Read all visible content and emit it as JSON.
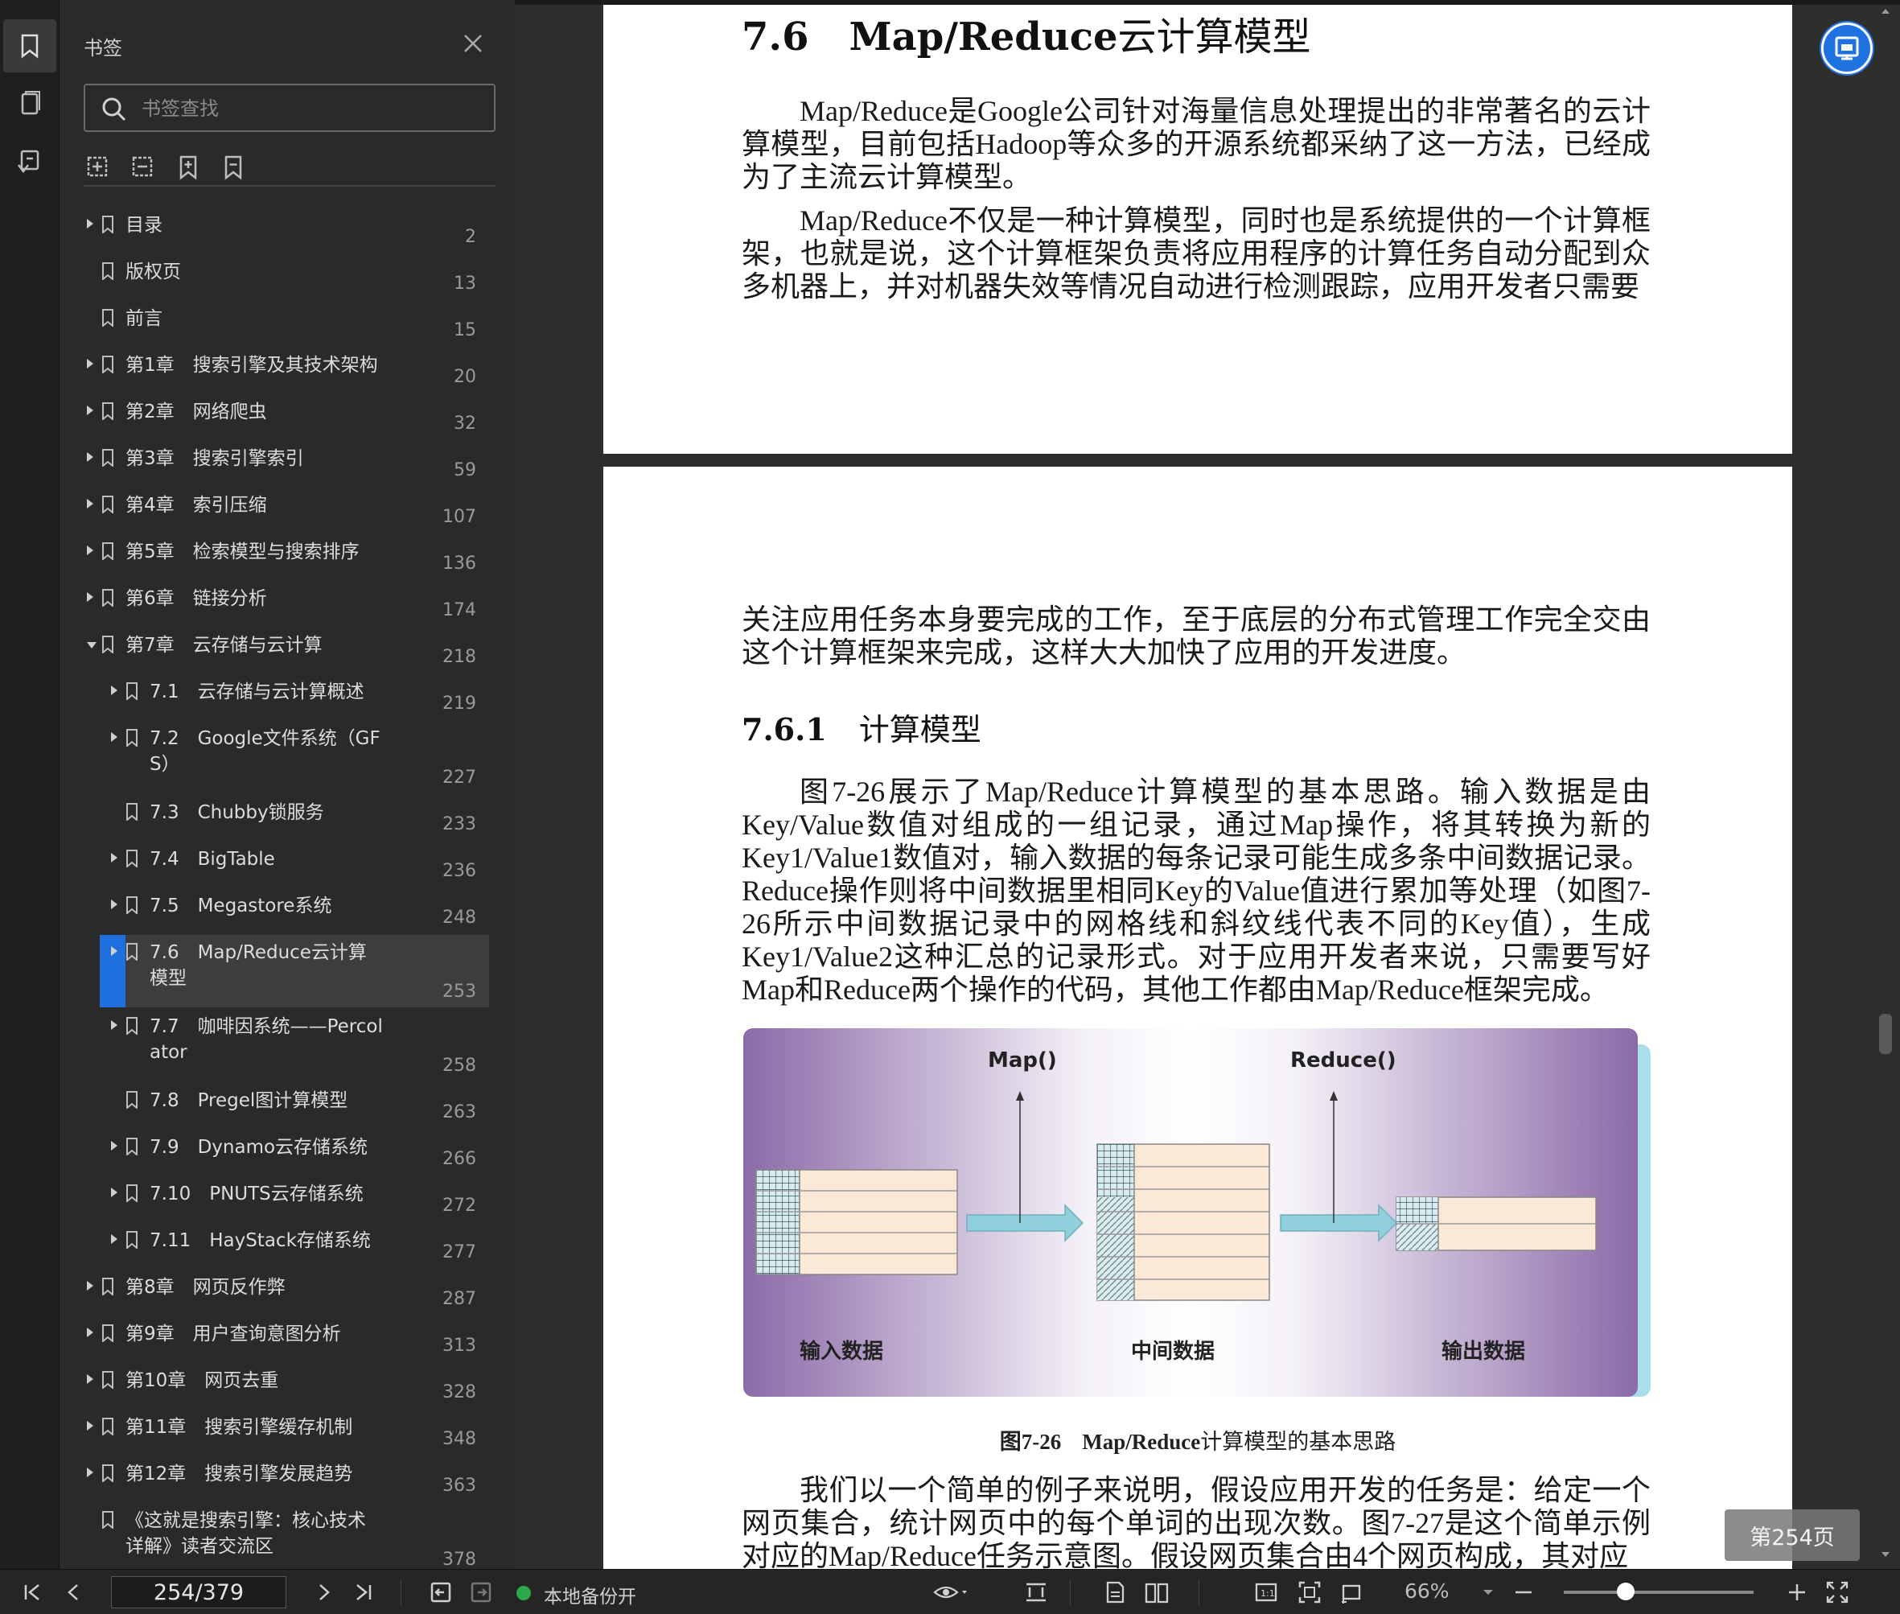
{
  "panel": {
    "title": "书签",
    "search_placeholder": "书签查找"
  },
  "bookmarks": [
    {
      "label": "目录",
      "page": "2",
      "level": 0,
      "arrow": "closed"
    },
    {
      "label": "版权页",
      "page": "13",
      "level": 0,
      "arrow": "none"
    },
    {
      "label": "前言",
      "page": "15",
      "level": 0,
      "arrow": "none"
    },
    {
      "label": "第1章　搜索引擎及其技术架构",
      "page": "20",
      "level": 0,
      "arrow": "closed"
    },
    {
      "label": "第2章　网络爬虫",
      "page": "32",
      "level": 0,
      "arrow": "closed"
    },
    {
      "label": "第3章　搜索引擎索引",
      "page": "59",
      "level": 0,
      "arrow": "closed"
    },
    {
      "label": "第4章　索引压缩",
      "page": "107",
      "level": 0,
      "arrow": "closed"
    },
    {
      "label": "第5章　检索模型与搜索排序",
      "page": "136",
      "level": 0,
      "arrow": "closed"
    },
    {
      "label": "第6章　链接分析",
      "page": "174",
      "level": 0,
      "arrow": "closed"
    },
    {
      "label": "第7章　云存储与云计算",
      "page": "218",
      "level": 0,
      "arrow": "open"
    },
    {
      "label": "7.1　云存储与云计算概述",
      "page": "219",
      "level": 1,
      "arrow": "closed"
    },
    {
      "label": "7.2　Google文件系统（GF\nS）",
      "page": "227",
      "level": 1,
      "arrow": "closed"
    },
    {
      "label": "7.3　Chubby锁服务",
      "page": "233",
      "level": 1,
      "arrow": "none"
    },
    {
      "label": "7.4　BigTable",
      "page": "236",
      "level": 1,
      "arrow": "closed"
    },
    {
      "label": "7.5　Megastore系统",
      "page": "248",
      "level": 1,
      "arrow": "closed"
    },
    {
      "label": "7.6　Map/Reduce云计算\n模型",
      "page": "253",
      "level": 1,
      "arrow": "closed",
      "selected": true
    },
    {
      "label": "7.7　咖啡因系统——Percol\nator",
      "page": "258",
      "level": 1,
      "arrow": "closed"
    },
    {
      "label": "7.8　Pregel图计算模型",
      "page": "263",
      "level": 1,
      "arrow": "none"
    },
    {
      "label": "7.9　Dynamo云存储系统",
      "page": "266",
      "level": 1,
      "arrow": "closed"
    },
    {
      "label": "7.10　PNUTS云存储系统",
      "page": "272",
      "level": 1,
      "arrow": "closed"
    },
    {
      "label": "7.11　HayStack存储系统",
      "page": "277",
      "level": 1,
      "arrow": "closed"
    },
    {
      "label": "第8章　网页反作弊",
      "page": "287",
      "level": 0,
      "arrow": "closed"
    },
    {
      "label": "第9章　用户查询意图分析",
      "page": "313",
      "level": 0,
      "arrow": "closed"
    },
    {
      "label": "第10章　网页去重",
      "page": "328",
      "level": 0,
      "arrow": "closed"
    },
    {
      "label": "第11章　搜索引擎缓存机制",
      "page": "348",
      "level": 0,
      "arrow": "closed"
    },
    {
      "label": "第12章　搜索引擎发展趋势",
      "page": "363",
      "level": 0,
      "arrow": "closed"
    },
    {
      "label": "《这就是搜索引擎：核心技术\n详解》读者交流区",
      "page": "378",
      "level": 0,
      "arrow": "none"
    }
  ],
  "doc": {
    "section_num": "7.6",
    "section_title_en": "Map/Reduce",
    "section_title_cn": "云计算模型",
    "p1": "Map/Reduce是Google公司针对海量信息处理提出的非常著名的云计算模型，目前包括Hadoop等众多的开源系统都采纳了这一方法，已经成为了主流云计算模型。",
    "p2": "Map/Reduce不仅是一种计算模型，同时也是系统提供的一个计算框架，也就是说，这个计算框架负责将应用程序的计算任务自动分配到众多机器上，并对机器失效等情况自动进行检测跟踪，应用开发者只需要",
    "p3": "关注应用任务本身要完成的工作，至于底层的分布式管理工作完全交由这个计算框架来完成，这样大大加快了应用的开发进度。",
    "sub_num": "7.6.1",
    "sub_title": "计算模型",
    "p4": "图7-26展示了Map/Reduce计算模型的基本思路。输入数据是由Key/Value数值对组成的一组记录，通过Map操作，将其转换为新的Key1/Value1数值对，输入数据的每条记录可能生成多条中间数据记录。Reduce操作则将中间数据里相同Key的Value值进行累加等处理（如图7-26所示中间数据记录中的网格线和斜纹线代表不同的Key值），生成Key1/Value2这种汇总的记录形式。对于应用开发者来说，只需要写好Map和Reduce两个操作的代码，其他工作都由Map/Reduce框架完成。",
    "figure": {
      "map_label": "Map()",
      "reduce_label": "Reduce()",
      "input_label": "输入数据",
      "middle_label": "中间数据",
      "output_label": "输出数据"
    },
    "caption_num": "图7-26",
    "caption_en": "Map/Reduce",
    "caption_cn": "计算模型的基本思路",
    "p5": "我们以一个简单的例子来说明，假设应用开发的任务是：给定一个网页集合，统计网页中的每个单词的出现次数。图7-27是这个简单示例对应的Map/Reduce任务示意图。假设网页集合由4个网页构成，其对应"
  },
  "page_badge": "第254页",
  "status": {
    "page_value": "254/379",
    "backup_label": "本地备份开",
    "zoom": "66%"
  }
}
